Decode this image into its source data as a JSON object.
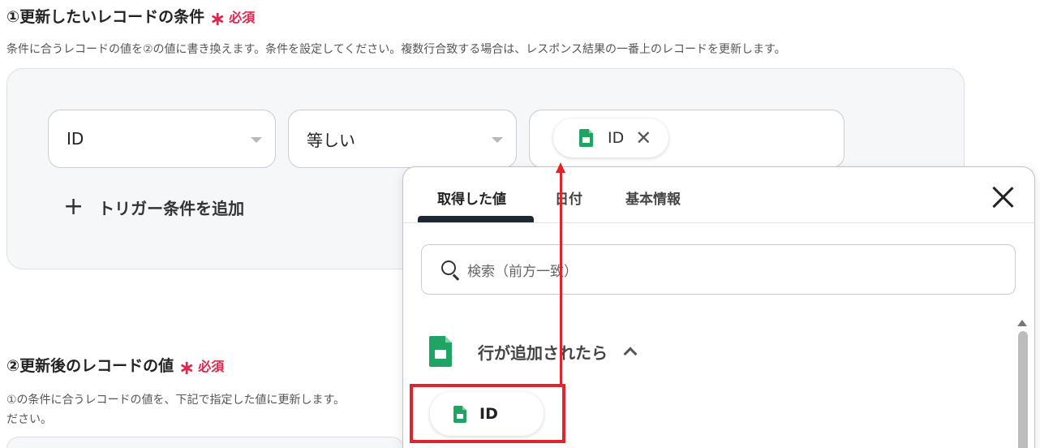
{
  "section1": {
    "title": "①更新したいレコードの条件",
    "required_label": "必須",
    "description": "条件に合うレコードの値を②の値に書き換えます。条件を設定してください。複数行合致する場合は、レスポンス結果の一番上のレコードを更新します。",
    "field_select": {
      "value": "ID"
    },
    "operator_select": {
      "value": "等しい"
    },
    "value_chip": {
      "label": "ID"
    },
    "add_condition_label": "トリガー条件を追加"
  },
  "section2": {
    "title": "②更新後のレコードの値",
    "required_label": "必須",
    "description_line1": "①の条件に合うレコードの値を、下記で指定した値に更新します。",
    "description_line2": "ださい。"
  },
  "popup": {
    "tabs": [
      {
        "label": "取得した値",
        "active": true
      },
      {
        "label": "日付",
        "active": false
      },
      {
        "label": "基本情報",
        "active": false
      }
    ],
    "search_placeholder": "検索（前方一致）",
    "group": {
      "label": "行が追加されたら",
      "icon": "google-sheets-icon",
      "expanded": true
    },
    "items": [
      {
        "label": "ID"
      }
    ]
  },
  "colors": {
    "required": "#e5244a",
    "annotation": "#e0242b",
    "sheets_green": "#1fa463",
    "active_tab": "#1f2733"
  }
}
